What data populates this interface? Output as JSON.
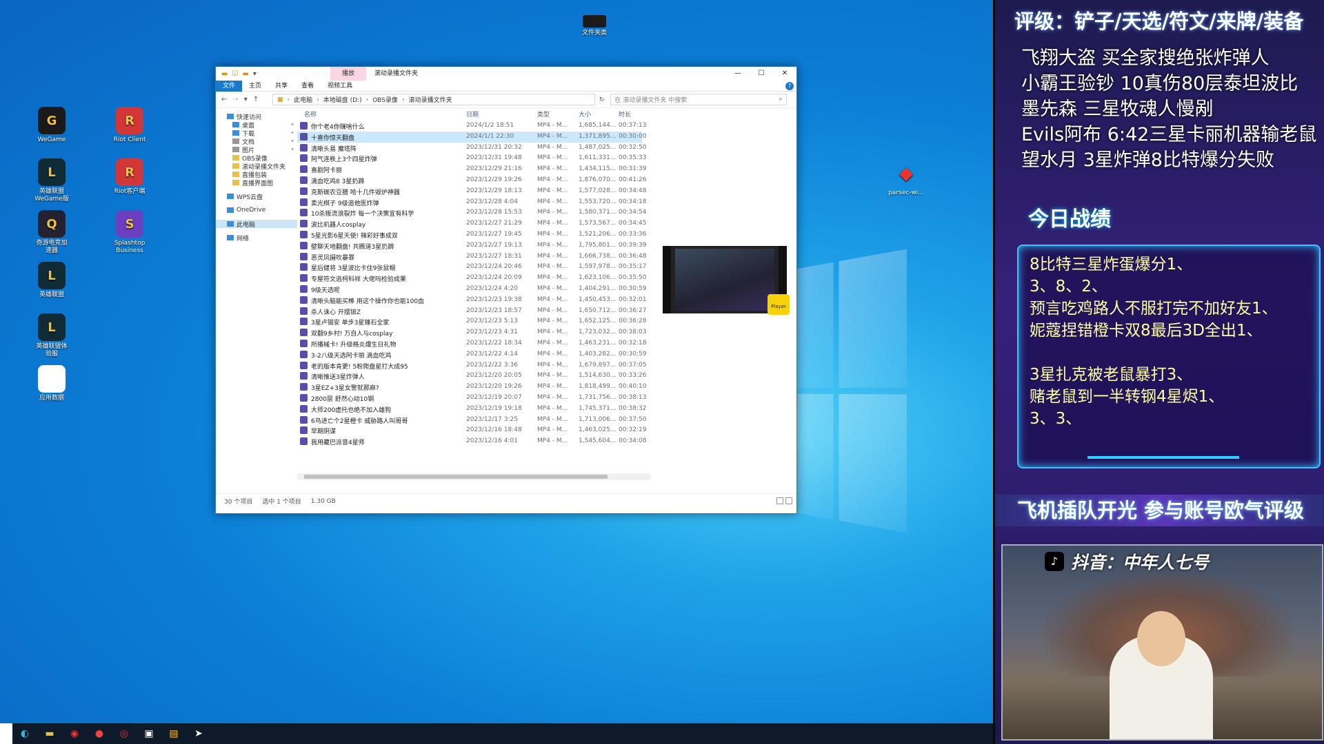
{
  "desktop": {
    "icons_left": [
      {
        "label": "WeGame",
        "icon": "wegame-icon",
        "color": "#1a1a1a"
      },
      {
        "label": "英雄联盟\nWeGame版",
        "icon": "lol-wegame-icon",
        "color": "#0e2b36"
      },
      {
        "label": "奇游电竞加\n速器",
        "icon": "qiyou-icon",
        "color": "#223"
      },
      {
        "label": "英雄联盟",
        "icon": "lol-icon",
        "color": "#0e2b36"
      },
      {
        "label": "英雄联盟体\n验服",
        "icon": "lol-pbe-icon",
        "color": "#0e2b36"
      },
      {
        "label": "应用数据",
        "icon": "document-icon",
        "color": "#ffffff"
      }
    ],
    "icons_mid": [
      {
        "label": "Riot Client",
        "icon": "riot-icon",
        "color": "#d13639"
      },
      {
        "label": "Riot客户端",
        "icon": "riot-icon",
        "color": "#d13639"
      },
      {
        "label": "Splashtop\nBusiness",
        "icon": "splashtop-icon",
        "color": "#6a3fc0"
      }
    ],
    "top_icon": {
      "label": "文件夹类",
      "icon": "folder-dark-icon"
    },
    "right_icon": {
      "label": "parsec-wi...",
      "icon": "parsec-icon"
    }
  },
  "explorer": {
    "ribbon_context": "播放",
    "title": "滚动录播文件夹",
    "ribbon_tabs": [
      "文件",
      "主页",
      "共享",
      "查看",
      "视频工具"
    ],
    "address": [
      "此电脑",
      "本地磁盘 (D:)",
      "OBS录像",
      "滚动录播文件夹"
    ],
    "search_placeholder": "在 滚动录播文件夹 中搜索",
    "nav": [
      {
        "label": "快速访问",
        "indent": 0,
        "icon": "star-icon",
        "pinned": false
      },
      {
        "label": "桌面",
        "indent": 1,
        "icon": "desktop-icon",
        "pinned": true
      },
      {
        "label": "下载",
        "indent": 1,
        "icon": "download-icon",
        "pinned": true
      },
      {
        "label": "文档",
        "indent": 1,
        "icon": "document-icon",
        "pinned": true
      },
      {
        "label": "图片",
        "indent": 1,
        "icon": "picture-icon",
        "pinned": true
      },
      {
        "label": "OBS录像",
        "indent": 1,
        "icon": "folder-icon",
        "pinned": false
      },
      {
        "label": "滚动录播文件夹",
        "indent": 1,
        "icon": "folder-icon",
        "pinned": false
      },
      {
        "label": "直播包装",
        "indent": 1,
        "icon": "folder-icon",
        "pinned": false
      },
      {
        "label": "直播界面图",
        "indent": 1,
        "icon": "folder-icon",
        "pinned": false
      },
      {
        "label": "WPS云盘",
        "indent": 0,
        "icon": "cloud-icon",
        "pinned": false
      },
      {
        "label": "OneDrive",
        "indent": 0,
        "icon": "onedrive-icon",
        "pinned": false
      },
      {
        "label": "此电脑",
        "indent": 0,
        "icon": "computer-icon",
        "pinned": false,
        "selected": true
      },
      {
        "label": "网络",
        "indent": 0,
        "icon": "network-icon",
        "pinned": false
      }
    ],
    "columns": {
      "name": "名称",
      "date": "日期",
      "type": "类型",
      "size": "大小",
      "duration": "时长"
    },
    "files": [
      {
        "name": "你个老4你赚啥什么",
        "date": "2024/1/2 18:51",
        "type": "MP4 - M...",
        "size": "1,685,144...",
        "duration": "00:37:13"
      },
      {
        "name": "十喜你惊天翻盘",
        "date": "2024/1/1 22:30",
        "type": "MP4 - M...",
        "size": "1,371,895...",
        "duration": "00:30:00",
        "selected": true
      },
      {
        "name": "清晰头易 魔塔阵",
        "date": "2023/12/31 20:32",
        "type": "MP4 - M...",
        "size": "1,487,025...",
        "duration": "00:32:50"
      },
      {
        "name": "阿气连秩上3个四星炸弹",
        "date": "2023/12/31 19:48",
        "type": "MP4 - M...",
        "size": "1,611,331...",
        "duration": "00:35:33"
      },
      {
        "name": "喜剧阿卡丽",
        "date": "2023/12/29 21:16",
        "type": "MP4 - M...",
        "size": "1,434,115...",
        "duration": "00:31:39"
      },
      {
        "name": "滴血吃鸡8 3星扔蹄",
        "date": "2023/12/29 19:26",
        "type": "MP4 - M...",
        "size": "1,876,070...",
        "duration": "00:41:26"
      },
      {
        "name": "克斯碳农豆腊 哈十几件毁炉神器",
        "date": "2023/12/29 18:13",
        "type": "MP4 - M...",
        "size": "1,577,028...",
        "duration": "00:34:48"
      },
      {
        "name": "卖光棋子 9级追他医炸弹",
        "date": "2023/12/28 4:04",
        "type": "MP4 - M...",
        "size": "1,553,720...",
        "duration": "00:34:18"
      },
      {
        "name": "10杀叛流浪裂炸 每一个决策宜有科学",
        "date": "2023/12/28 15:53",
        "type": "MP4 - M...",
        "size": "1,580,371...",
        "duration": "00:34:54"
      },
      {
        "name": "波比机器人cosplay",
        "date": "2023/12/27 21:29",
        "type": "MP4 - M...",
        "size": "1,573,567...",
        "duration": "00:34:45"
      },
      {
        "name": "5星光影6星天使! 辣彩好事成双",
        "date": "2023/12/27 19:45",
        "type": "MP4 - M...",
        "size": "1,521,206...",
        "duration": "00:33:36"
      },
      {
        "name": "壁聊天地翻盘! 共腾道3星扔蹄",
        "date": "2023/12/27 19:13",
        "type": "MP4 - M...",
        "size": "1,795,801...",
        "duration": "00:39:39"
      },
      {
        "name": "恶灵凤摄吹暴罪",
        "date": "2023/12/27 18:31",
        "type": "MP4 - M...",
        "size": "1,666,738...",
        "duration": "00:36:48"
      },
      {
        "name": "星后健将 3星波比卡住9张鼠帽",
        "date": "2023/12/24 20:46",
        "type": "MP4 - M...",
        "size": "1,597,978...",
        "duration": "00:35:17"
      },
      {
        "name": "专屋符文逃柯科祥 大佬吗检验成果",
        "date": "2023/12/24 20:09",
        "type": "MP4 - M...",
        "size": "1,623,106...",
        "duration": "00:35:50"
      },
      {
        "name": "9级天选呢",
        "date": "2023/12/24 4:20",
        "type": "MP4 - M...",
        "size": "1,404,291...",
        "duration": "00:30:59"
      },
      {
        "name": "清晰头脑能买棒 用这个操作你也能100血",
        "date": "2023/12/23 19:38",
        "type": "MP4 - M...",
        "size": "1,450,453...",
        "duration": "00:32:01"
      },
      {
        "name": "杀人诛心 开摆锁Z",
        "date": "2023/12/23 18:57",
        "type": "MP4 - M...",
        "size": "1,650,712...",
        "duration": "00:36:27"
      },
      {
        "name": "3星卢锡安 单步3星锤石全家",
        "date": "2023/12/23 5:13",
        "type": "MP4 - M...",
        "size": "1,652,125...",
        "duration": "00:36:28"
      },
      {
        "name": "双翻9乡村! 万自人与cosplay",
        "date": "2023/12/23 4:31",
        "type": "MP4 - M...",
        "size": "1,723,032...",
        "duration": "00:38:03"
      },
      {
        "name": "所播械卡! 升级格炎爆生日礼物",
        "date": "2023/12/22 18:34",
        "type": "MP4 - M...",
        "size": "1,463,231...",
        "duration": "00:32:18"
      },
      {
        "name": "3-2八级天选阿卡丽 滴血吃鸡",
        "date": "2023/12/22 4:14",
        "type": "MP4 - M...",
        "size": "1,403,282...",
        "duration": "00:30:59"
      },
      {
        "name": "老的版本肯更! 5粉爬盘星打大成95",
        "date": "2023/12/22 3:36",
        "type": "MP4 - M...",
        "size": "1,679,897...",
        "duration": "00:37:05"
      },
      {
        "name": "清晰推送3星炸弹人",
        "date": "2023/12/20 20:05",
        "type": "MP4 - M...",
        "size": "1,514,630...",
        "duration": "00:33:26"
      },
      {
        "name": "3星EZ+3星女警就那麻?",
        "date": "2023/12/20 19:26",
        "type": "MP4 - M...",
        "size": "1,818,499...",
        "duration": "00:40:10"
      },
      {
        "name": "2800层 舒然心动10钢",
        "date": "2023/12/19 20:07",
        "type": "MP4 - M...",
        "size": "1,731,756...",
        "duration": "00:38:13"
      },
      {
        "name": "大师200虚托也绝不加入雄狗",
        "date": "2023/12/19 19:18",
        "type": "MP4 - M...",
        "size": "1,745,371...",
        "duration": "00:38:32"
      },
      {
        "name": "6鸟进亡个2星橙卡 威胁路人叫哥哥",
        "date": "2023/12/17 3:25",
        "type": "MP4 - M...",
        "size": "1,713,006...",
        "duration": "00:37:50"
      },
      {
        "name": "早期阴谋",
        "date": "2023/12/16 18:48",
        "type": "MP4 - M...",
        "size": "1,463,025...",
        "duration": "00:32:19"
      },
      {
        "name": "我用藏巴派音4星师",
        "date": "2023/12/16 4:01",
        "type": "MP4 - M...",
        "size": "1,545,604...",
        "duration": "00:34:08"
      }
    ],
    "preview_badge": "Player",
    "status": {
      "count": "30 个项目",
      "selected": "选中 1 个项目",
      "size": "1.30 GB"
    }
  },
  "taskbar": {
    "icons": [
      "edge-icon",
      "file-explorer-icon",
      "qiyou-icon",
      "obs-icon",
      "netease-music-icon",
      "splashtop-icon",
      "sticky-notes-icon",
      "feishu-icon"
    ]
  },
  "overlay": {
    "rating": "评级：铲子/天选/符文/来牌/装备",
    "supporters": [
      "飞翔大盗 买全家搜绝张炸弹人",
      "小霸王验钞 10真伤80层泰坦波比",
      "墨先森 三星牧魂人慢剐",
      "Evils阿布 6:42三星卡丽机器输老鼠",
      "望水月 3星炸弹8比特爆分失败"
    ],
    "today_title": "今日战绩",
    "records": [
      "8比特三星炸蛋爆分1、",
      "3、8、2、",
      "预言吃鸡路人不服打完不加好友1、",
      "妮蔻捏错橙卡双8最后3D全出1、",
      "",
      "3星扎克被老鼠暴打3、",
      "赌老鼠到一半转钢4星烬1、",
      "3、3、"
    ],
    "banner": "飞机插队开光 参与账号欧气评级",
    "douyin": "抖音：中年人七号"
  }
}
